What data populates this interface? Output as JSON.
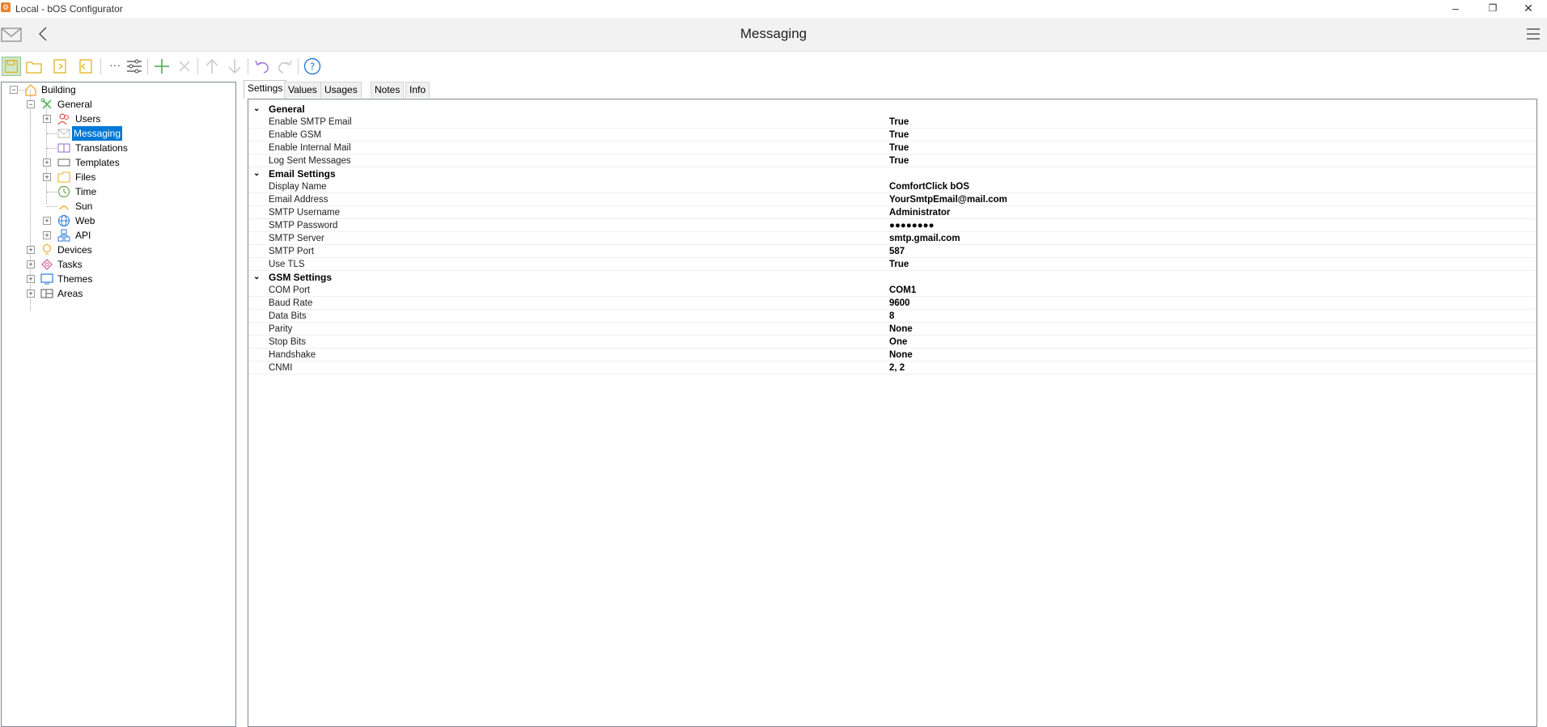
{
  "window": {
    "title": "Local - bOS Configurator",
    "app_icon": "gear-icon"
  },
  "header": {
    "title": "Messaging"
  },
  "tree": [
    {
      "label": "Building",
      "icon": "house-icon"
    },
    {
      "label": "General",
      "icon": "tools-icon"
    },
    {
      "label": "Users",
      "icon": "users-icon"
    },
    {
      "label": "Messaging",
      "icon": "envelope-icon"
    },
    {
      "label": "Translations",
      "icon": "book-icon"
    },
    {
      "label": "Templates",
      "icon": "template-icon"
    },
    {
      "label": "Files",
      "icon": "folder-icon"
    },
    {
      "label": "Time",
      "icon": "clock-icon"
    },
    {
      "label": "Sun",
      "icon": "sun-icon"
    },
    {
      "label": "Web",
      "icon": "globe-icon"
    },
    {
      "label": "API",
      "icon": "network-icon"
    },
    {
      "label": "Devices",
      "icon": "bulb-icon"
    },
    {
      "label": "Tasks",
      "icon": "tasks-icon"
    },
    {
      "label": "Themes",
      "icon": "monitor-icon"
    },
    {
      "label": "Areas",
      "icon": "areas-icon"
    }
  ],
  "tabs": [
    "Settings",
    "Values",
    "Usages (0)",
    "Notes",
    "Info"
  ],
  "sections": [
    {
      "title": "General",
      "rows": [
        {
          "name": "Enable SMTP Email",
          "value": "True"
        },
        {
          "name": "Enable GSM",
          "value": "True"
        },
        {
          "name": "Enable Internal Mail",
          "value": "True"
        },
        {
          "name": "Log Sent Messages",
          "value": "True"
        }
      ]
    },
    {
      "title": "Email Settings",
      "rows": [
        {
          "name": "Display Name",
          "value": "ComfortClick bOS"
        },
        {
          "name": "Email Address",
          "value": "YourSmtpEmail@mail.com"
        },
        {
          "name": "SMTP Username",
          "value": "Administrator"
        },
        {
          "name": "SMTP Password",
          "value": "●●●●●●●●"
        },
        {
          "name": "SMTP Server",
          "value": "smtp.gmail.com"
        },
        {
          "name": "SMTP Port",
          "value": "587"
        },
        {
          "name": "Use TLS",
          "value": "True"
        }
      ]
    },
    {
      "title": "GSM Settings",
      "rows": [
        {
          "name": "COM Port",
          "value": "COM1"
        },
        {
          "name": "Baud Rate",
          "value": "9600"
        },
        {
          "name": "Data Bits",
          "value": "8"
        },
        {
          "name": "Parity",
          "value": "None"
        },
        {
          "name": "Stop Bits",
          "value": "One"
        },
        {
          "name": "Handshake",
          "value": "None"
        },
        {
          "name": "CNMI",
          "value": "2, 2"
        }
      ]
    }
  ]
}
